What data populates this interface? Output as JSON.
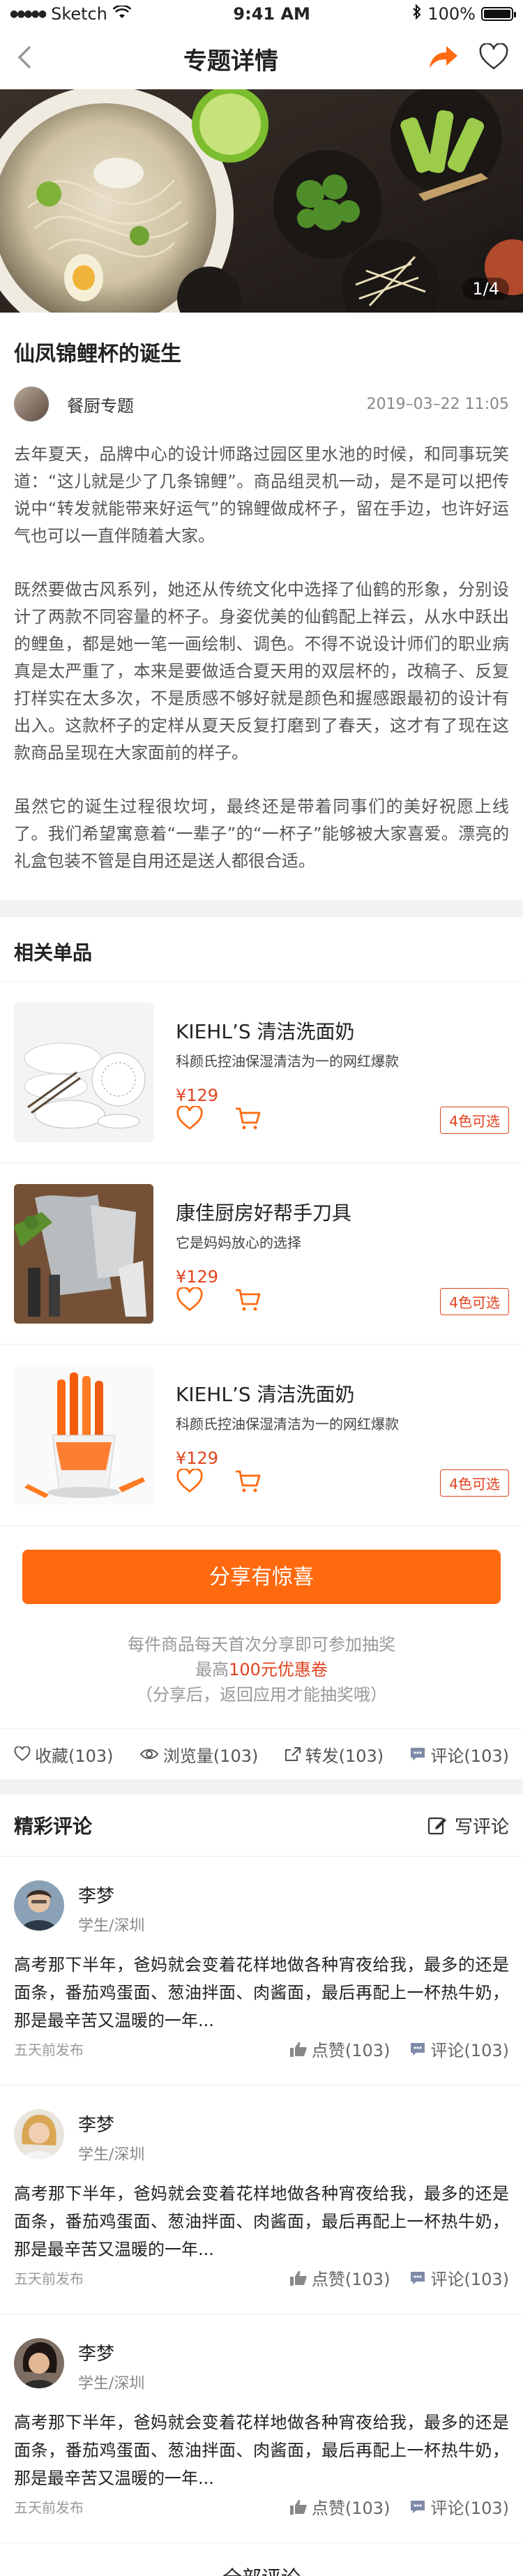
{
  "status": {
    "carrier": "Sketch",
    "time": "9:41 AM",
    "battery": "100%"
  },
  "nav": {
    "title": "专题详情"
  },
  "hero": {
    "pager": "1/4"
  },
  "article": {
    "title": "仙凤锦鲤杯的诞生",
    "author": "餐厨专题",
    "date": "2019–03–22 11:05",
    "paragraphs": [
      "去年夏天，品牌中心的设计师路过园区里水池的时候，和同事玩笑道：“这儿就是少了几条锦鲤”。商品组灵机一动，是不是可以把传说中“转发就能带来好运气”的锦鲤做成杯子，留在手边，也许好运气也可以一直伴随着大家。",
      "既然要做古风系列，她还从传统文化中选择了仙鹤的形象，分别设计了两款不同容量的杯子。身姿优美的仙鹤配上祥云，从水中跃出的鲤鱼，都是她一笔一画绘制、调色。不得不说设计师们的职业病真是太严重了，本来是要做适合夏天用的双层杯的，改稿子、反复打样实在太多次，不是质感不够好就是颜色和握感跟最初的设计有出入。这款杯子的定样从夏天反复打磨到了春天，这才有了现在这款商品呈现在大家面前的样子。",
      "虽然它的诞生过程很坎坷，最终还是带着同事们的美好祝愿上线了。我们希望寓意着“一辈子”的“一杯子”能够被大家喜爱。漂亮的礼盒包装不管是自用还是送人都很合适。"
    ]
  },
  "products": {
    "title": "相关单品",
    "items": [
      {
        "name": "KIEHL’S 清洁洗面奶",
        "desc": "科颜氏控油保湿清洁为一的网红爆款",
        "price": "¥129",
        "colors": "4色可选"
      },
      {
        "name": "康佳厨房好帮手刀具",
        "desc": "它是妈妈放心的选择",
        "price": "¥129",
        "colors": "4色可选"
      },
      {
        "name": "KIEHL’S 清洁洗面奶",
        "desc": "科颜氏控油保湿清洁为一的网红爆款",
        "price": "¥129",
        "colors": "4色可选"
      }
    ]
  },
  "share": {
    "button": "分享有惊喜",
    "line1": "每件商品每天首次分享即可参加抽奖",
    "line2_pre": "最高",
    "line2_hl": "100元优惠卷",
    "line3": "（分享后，返回应用才能抽奖哦）"
  },
  "stats": {
    "favorites": "收藏(103)",
    "views": "浏览量(103)",
    "forwards": "转发(103)",
    "comments": "评论(103)"
  },
  "comments": {
    "title": "精彩评论",
    "write": "写评论",
    "all": "全部评论",
    "items": [
      {
        "name": "李梦",
        "role": "学生/深圳",
        "text": "高考那下半年，爸妈就会变着花样地做各种宵夜给我，最多的还是面条，番茄鸡蛋面、葱油拌面、肉酱面，最后再配上一杯热牛奶，那是最辛苦又温暖的一年...",
        "ago": "五天前发布",
        "likes": "点赞(103)",
        "replies": "评论(103)"
      },
      {
        "name": "李梦",
        "role": "学生/深圳",
        "text": "高考那下半年，爸妈就会变着花样地做各种宵夜给我，最多的还是面条，番茄鸡蛋面、葱油拌面、肉酱面，最后再配上一杯热牛奶，那是最辛苦又温暖的一年...",
        "ago": "五天前发布",
        "likes": "点赞(103)",
        "replies": "评论(103)"
      },
      {
        "name": "李梦",
        "role": "学生/深圳",
        "text": "高考那下半年，爸妈就会变着花样地做各种宵夜给我，最多的还是面条，番茄鸡蛋面、葱油拌面、肉酱面，最后再配上一杯热牛奶，那是最辛苦又温暖的一年...",
        "ago": "五天前发布",
        "likes": "点赞(103)",
        "replies": "评论(103)"
      }
    ]
  },
  "colors": {
    "accent": "#ff6a10",
    "price": "#e2421e"
  }
}
